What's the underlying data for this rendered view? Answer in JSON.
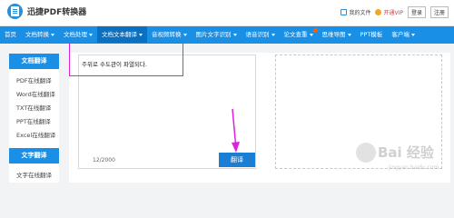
{
  "header": {
    "logo_text": "迅捷PDF转换器",
    "my_files": "我的文件",
    "vip": "开通VIP",
    "login": "登录",
    "register": "注册"
  },
  "nav": {
    "items": [
      {
        "label": "首页",
        "caret": false
      },
      {
        "label": "文档转换",
        "caret": true
      },
      {
        "label": "文档处理",
        "caret": true
      },
      {
        "label": "文档文本翻译",
        "caret": true
      },
      {
        "label": "音视频转换",
        "caret": true
      },
      {
        "label": "图片文字识别",
        "caret": true
      },
      {
        "label": "语音识别",
        "caret": true
      },
      {
        "label": "论文查重",
        "caret": true
      },
      {
        "label": "思维导图",
        "caret": true
      },
      {
        "label": "PPT模板",
        "caret": false
      },
      {
        "label": "客户端",
        "caret": true
      }
    ]
  },
  "sidebar": {
    "section1_title": "文档翻译",
    "section1_items": [
      "PDF在线翻译",
      "Word在线翻译",
      "TXT在线翻译",
      "PPT在线翻译",
      "Excel在线翻译"
    ],
    "section2_title": "文字翻译",
    "section2_items": [
      "文字在线翻译"
    ]
  },
  "main": {
    "source_text": "주위로 수도관이 파열되다.",
    "counter": "12/2000",
    "translate_button": "翻译"
  },
  "watermark": {
    "title": "Bai 经验",
    "sub": "jingyan.baidu.com"
  }
}
